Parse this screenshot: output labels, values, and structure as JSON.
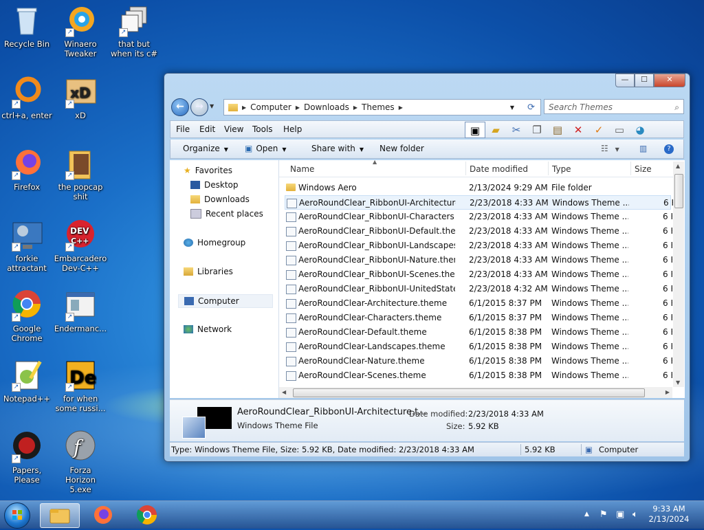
{
  "desktop_icons": [
    {
      "label": "Recycle Bin"
    },
    {
      "label": "Winaero Tweaker"
    },
    {
      "label": "that but when its c#"
    },
    {
      "label": "ctrl+a, enter"
    },
    {
      "label": "xD"
    },
    {
      "label": "Firefox"
    },
    {
      "label": "the popcap shit"
    },
    {
      "label": "forkie attractant"
    },
    {
      "label": "Embarcadero Dev-C++"
    },
    {
      "label": "Google Chrome"
    },
    {
      "label": "Endermanc..."
    },
    {
      "label": "Notepad++"
    },
    {
      "label": "for when some russi..."
    },
    {
      "label": "Papers, Please"
    },
    {
      "label": "Forza Horizon 5.exe"
    }
  ],
  "window": {
    "caption": {
      "min": "—",
      "max": "☐",
      "close": "✕"
    },
    "address": {
      "segments": [
        "Computer",
        "Downloads",
        "Themes"
      ]
    },
    "search_placeholder": "Search Themes",
    "menu": [
      "File",
      "Edit",
      "View",
      "Tools",
      "Help"
    ],
    "commands": {
      "organize": "Organize",
      "open": "Open",
      "share": "Share with",
      "new_folder": "New folder"
    },
    "nav": {
      "favorites": "Favorites",
      "desktop": "Desktop",
      "downloads": "Downloads",
      "recent": "Recent places",
      "homegroup": "Homegroup",
      "libraries": "Libraries",
      "computer": "Computer",
      "network": "Network"
    },
    "columns": {
      "name": "Name",
      "date": "Date modified",
      "type": "Type",
      "size": "Size"
    },
    "files": [
      {
        "name": "Windows Aero",
        "date": "2/13/2024 9:29 AM",
        "type": "File folder",
        "size": ""
      },
      {
        "name": "AeroRoundClear_RibbonUI-Architecture....",
        "date": "2/23/2018 4:33 AM",
        "type": "Windows Theme ...",
        "size": "6 K"
      },
      {
        "name": "AeroRoundClear_RibbonUI-Characters.th...",
        "date": "2/23/2018 4:33 AM",
        "type": "Windows Theme ...",
        "size": "6 K"
      },
      {
        "name": "AeroRoundClear_RibbonUI-Default.theme",
        "date": "2/23/2018 4:33 AM",
        "type": "Windows Theme ...",
        "size": "6 K"
      },
      {
        "name": "AeroRoundClear_RibbonUI-Landscapes.t...",
        "date": "2/23/2018 4:33 AM",
        "type": "Windows Theme ...",
        "size": "6 K"
      },
      {
        "name": "AeroRoundClear_RibbonUI-Nature.theme",
        "date": "2/23/2018 4:33 AM",
        "type": "Windows Theme ...",
        "size": "6 K"
      },
      {
        "name": "AeroRoundClear_RibbonUI-Scenes.theme",
        "date": "2/23/2018 4:33 AM",
        "type": "Windows Theme ...",
        "size": "6 K"
      },
      {
        "name": "AeroRoundClear_RibbonUI-UnitedStates....",
        "date": "2/23/2018 4:32 AM",
        "type": "Windows Theme ...",
        "size": "6 K"
      },
      {
        "name": "AeroRoundClear-Architecture.theme",
        "date": "6/1/2015 8:37 PM",
        "type": "Windows Theme ...",
        "size": "6 K"
      },
      {
        "name": "AeroRoundClear-Characters.theme",
        "date": "6/1/2015 8:37 PM",
        "type": "Windows Theme ...",
        "size": "6 K"
      },
      {
        "name": "AeroRoundClear-Default.theme",
        "date": "6/1/2015 8:38 PM",
        "type": "Windows Theme ...",
        "size": "6 K"
      },
      {
        "name": "AeroRoundClear-Landscapes.theme",
        "date": "6/1/2015 8:38 PM",
        "type": "Windows Theme ...",
        "size": "6 K"
      },
      {
        "name": "AeroRoundClear-Nature.theme",
        "date": "6/1/2015 8:38 PM",
        "type": "Windows Theme ...",
        "size": "6 K"
      },
      {
        "name": "AeroRoundClear-Scenes.theme",
        "date": "6/1/2015 8:38 PM",
        "type": "Windows Theme ...",
        "size": "6 K"
      }
    ],
    "details": {
      "name": "AeroRoundClear_RibbonUI-Architecture.t...",
      "type": "Windows Theme File",
      "date_label": "Date modified:",
      "date_value": "2/23/2018 4:33 AM",
      "size_label": "Size:",
      "size_value": "5.92 KB"
    },
    "status": {
      "text": "Type: Windows Theme File, Size: 5.92 KB, Date modified: 2/23/2018 4:33 AM",
      "size": "5.92 KB",
      "location": "Computer"
    }
  },
  "taskbar": {
    "time": "9:33 AM",
    "date": "2/13/2024"
  }
}
